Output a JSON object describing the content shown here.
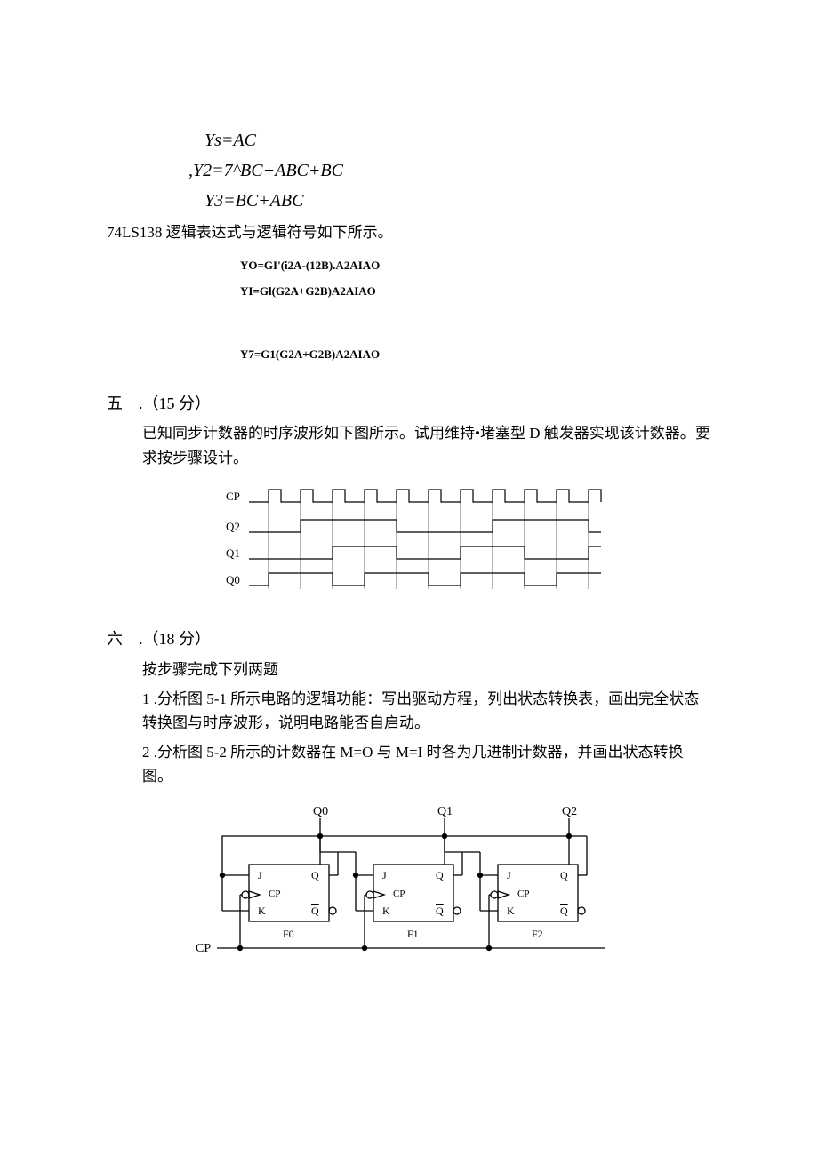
{
  "equations": {
    "ys": "Ys=AC",
    "y2": ",Y2=7^BC+ABC+BC",
    "y3": "Y3=BC+ABC"
  },
  "line_74ls": "74LS138 逻辑表达式与逻辑符号如下所示。",
  "logic_exprs": {
    "y0": "YO=GI'(i2A-(12B).A2AIAO",
    "yi": "YI=Gl(G2A+G2B)A2AIAO",
    "y7": "Y7=G1(G2A+G2B)A2AIAO"
  },
  "section5": {
    "head": "五　.（15 分）",
    "body": "已知同步计数器的时序波形如下图所示。试用维持•堵塞型 D 触发器实现该计数器。要求按步骤设计。"
  },
  "timing_labels": {
    "cp": "CP",
    "q2": "Q2",
    "q1": "Q1",
    "q0": "Q0"
  },
  "section6": {
    "head": "六　.（18 分）",
    "intro": "按步骤完成下列两题",
    "item1": "1 .分析图 5-1 所示电路的逻辑功能：写出驱动方程，列出状态转换表，画出完全状态转换图与时序波形，说明电路能否自启动。",
    "item2": "2 .分析图 5-2 所示的计数器在 M=O 与 M=I 时各为几进制计数器，并画出状态转换图。"
  },
  "circuit": {
    "outputs": {
      "q0": "Q0",
      "q1": "Q1",
      "q2": "Q2"
    },
    "ff": {
      "j": "J",
      "k": "K",
      "q": "Q",
      "qb": "Q",
      "cp": "CP"
    },
    "names": {
      "f0": "F0",
      "f1": "F1",
      "f2": "F2"
    },
    "cp_label": "CP"
  }
}
